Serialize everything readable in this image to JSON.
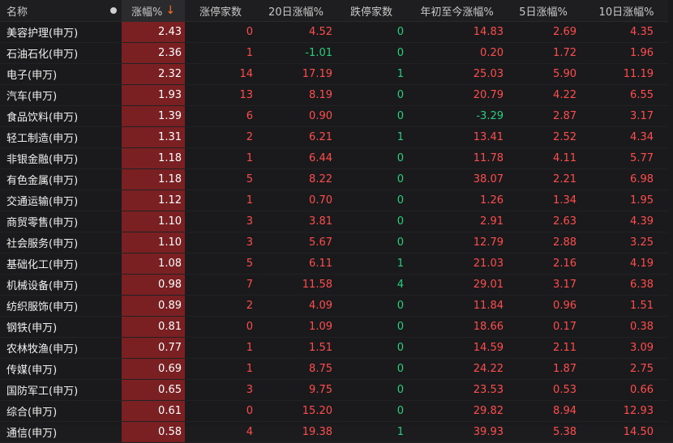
{
  "header": {
    "name": "名称",
    "pct": "涨幅%",
    "sort_arrow": "↓",
    "zt": "涨停家数",
    "chg20": "20日涨幅%",
    "dt": "跌停家数",
    "ytd": "年初至今涨幅%",
    "chg5": "5日涨幅%",
    "chg10": "10日涨幅%"
  },
  "rows": [
    {
      "name": "美容护理(申万)",
      "pct": "2.43",
      "zt": "0",
      "chg20": "4.52",
      "dt": "0",
      "ytd": "14.83",
      "chg5": "2.69",
      "chg10": "4.35"
    },
    {
      "name": "石油石化(申万)",
      "pct": "2.36",
      "zt": "1",
      "chg20": "-1.01",
      "dt": "0",
      "ytd": "0.20",
      "chg5": "1.72",
      "chg10": "1.96"
    },
    {
      "name": "电子(申万)",
      "pct": "2.32",
      "zt": "14",
      "chg20": "17.19",
      "dt": "1",
      "ytd": "25.03",
      "chg5": "5.90",
      "chg10": "11.19"
    },
    {
      "name": "汽车(申万)",
      "pct": "1.93",
      "zt": "13",
      "chg20": "8.19",
      "dt": "0",
      "ytd": "20.79",
      "chg5": "4.22",
      "chg10": "6.55"
    },
    {
      "name": "食品饮料(申万)",
      "pct": "1.39",
      "zt": "6",
      "chg20": "0.90",
      "dt": "0",
      "ytd": "-3.29",
      "chg5": "2.87",
      "chg10": "3.17"
    },
    {
      "name": "轻工制造(申万)",
      "pct": "1.31",
      "zt": "2",
      "chg20": "6.21",
      "dt": "1",
      "ytd": "13.41",
      "chg5": "2.52",
      "chg10": "4.34"
    },
    {
      "name": "非银金融(申万)",
      "pct": "1.18",
      "zt": "1",
      "chg20": "6.44",
      "dt": "0",
      "ytd": "11.78",
      "chg5": "4.11",
      "chg10": "5.77"
    },
    {
      "name": "有色金属(申万)",
      "pct": "1.18",
      "zt": "5",
      "chg20": "8.22",
      "dt": "0",
      "ytd": "38.07",
      "chg5": "2.21",
      "chg10": "6.98"
    },
    {
      "name": "交通运输(申万)",
      "pct": "1.12",
      "zt": "1",
      "chg20": "0.70",
      "dt": "0",
      "ytd": "1.26",
      "chg5": "1.34",
      "chg10": "1.95"
    },
    {
      "name": "商贸零售(申万)",
      "pct": "1.10",
      "zt": "3",
      "chg20": "3.81",
      "dt": "0",
      "ytd": "2.91",
      "chg5": "2.63",
      "chg10": "4.39"
    },
    {
      "name": "社会服务(申万)",
      "pct": "1.10",
      "zt": "3",
      "chg20": "5.67",
      "dt": "0",
      "ytd": "12.79",
      "chg5": "2.88",
      "chg10": "3.25"
    },
    {
      "name": "基础化工(申万)",
      "pct": "1.08",
      "zt": "5",
      "chg20": "6.11",
      "dt": "1",
      "ytd": "21.03",
      "chg5": "2.16",
      "chg10": "4.19"
    },
    {
      "name": "机械设备(申万)",
      "pct": "0.98",
      "zt": "7",
      "chg20": "11.58",
      "dt": "4",
      "ytd": "29.01",
      "chg5": "3.17",
      "chg10": "6.38"
    },
    {
      "name": "纺织服饰(申万)",
      "pct": "0.89",
      "zt": "2",
      "chg20": "4.09",
      "dt": "0",
      "ytd": "11.84",
      "chg5": "0.96",
      "chg10": "1.51"
    },
    {
      "name": "钢铁(申万)",
      "pct": "0.81",
      "zt": "0",
      "chg20": "1.09",
      "dt": "0",
      "ytd": "18.66",
      "chg5": "0.17",
      "chg10": "0.38"
    },
    {
      "name": "农林牧渔(申万)",
      "pct": "0.77",
      "zt": "1",
      "chg20": "1.51",
      "dt": "0",
      "ytd": "14.59",
      "chg5": "2.11",
      "chg10": "3.09"
    },
    {
      "name": "传媒(申万)",
      "pct": "0.69",
      "zt": "1",
      "chg20": "8.75",
      "dt": "0",
      "ytd": "24.22",
      "chg5": "1.87",
      "chg10": "2.75"
    },
    {
      "name": "国防军工(申万)",
      "pct": "0.65",
      "zt": "3",
      "chg20": "9.75",
      "dt": "0",
      "ytd": "23.53",
      "chg5": "0.53",
      "chg10": "0.66"
    },
    {
      "name": "综合(申万)",
      "pct": "0.61",
      "zt": "0",
      "chg20": "15.20",
      "dt": "0",
      "ytd": "29.82",
      "chg5": "8.94",
      "chg10": "12.93"
    },
    {
      "name": "通信(申万)",
      "pct": "0.58",
      "zt": "4",
      "chg20": "19.38",
      "dt": "1",
      "ytd": "39.93",
      "chg5": "5.38",
      "chg10": "14.50"
    }
  ],
  "colors": {
    "up": "#ff4d4d",
    "down": "#26d07c",
    "highlight": "#7a1f22"
  }
}
